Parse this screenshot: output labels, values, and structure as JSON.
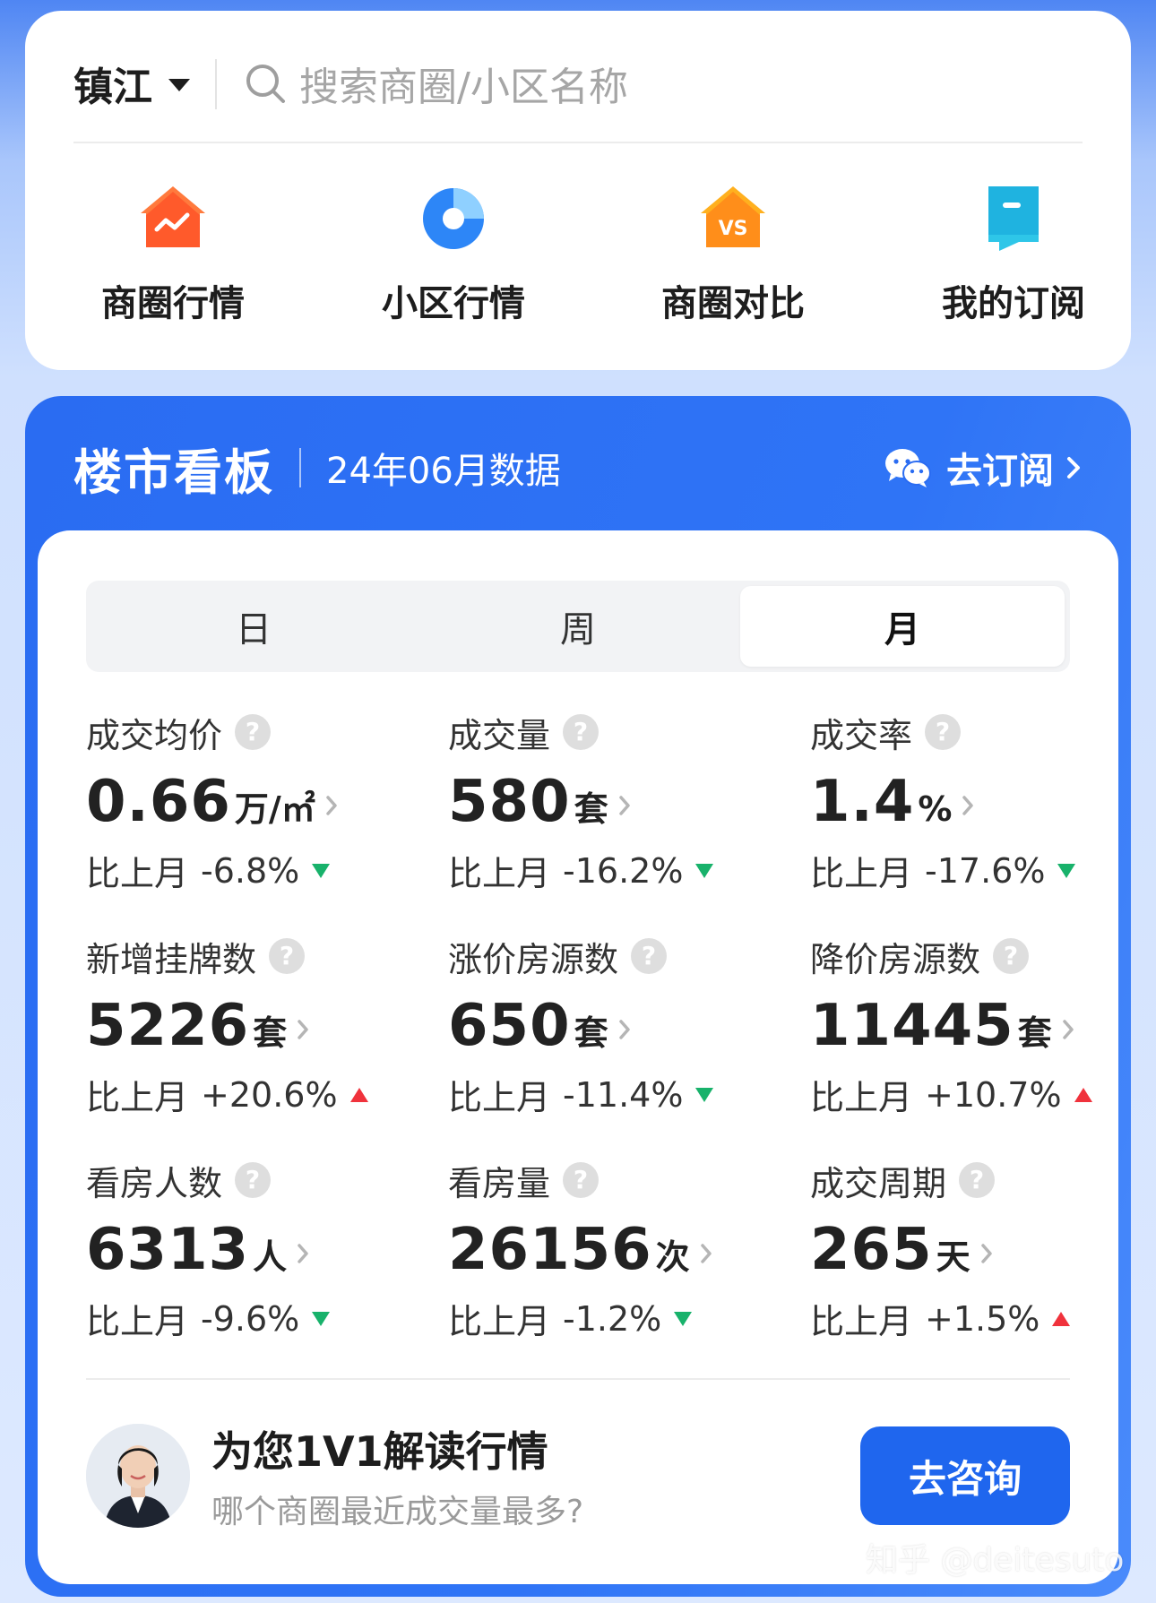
{
  "header": {
    "city": "镇江",
    "search_placeholder": "搜索商圈/小区名称"
  },
  "menu": [
    {
      "label": "商圈行情",
      "icon": "house-trend-icon"
    },
    {
      "label": "小区行情",
      "icon": "pie-chart-icon"
    },
    {
      "label": "商圈对比",
      "icon": "vs-house-icon"
    },
    {
      "label": "我的订阅",
      "icon": "bookmark-icon"
    }
  ],
  "dashboard": {
    "title": "楼市看板",
    "subtitle": "24年06月数据",
    "subscribe_label": "去订阅"
  },
  "tabs": [
    {
      "label": "日",
      "active": false
    },
    {
      "label": "周",
      "active": false
    },
    {
      "label": "月",
      "active": true
    }
  ],
  "metrics": [
    {
      "label": "成交均价",
      "value": "0.66",
      "unit": "万/㎡",
      "compare_label": "比上月",
      "change": "-6.8%",
      "trend": "down"
    },
    {
      "label": "成交量",
      "value": "580",
      "unit": "套",
      "compare_label": "比上月",
      "change": "-16.2%",
      "trend": "down"
    },
    {
      "label": "成交率",
      "value": "1.4",
      "unit": "%",
      "compare_label": "比上月",
      "change": "-17.6%",
      "trend": "down"
    },
    {
      "label": "新增挂牌数",
      "value": "5226",
      "unit": "套",
      "compare_label": "比上月",
      "change": "+20.6%",
      "trend": "up"
    },
    {
      "label": "涨价房源数",
      "value": "650",
      "unit": "套",
      "compare_label": "比上月",
      "change": "-11.4%",
      "trend": "down"
    },
    {
      "label": "降价房源数",
      "value": "11445",
      "unit": "套",
      "compare_label": "比上月",
      "change": "+10.7%",
      "trend": "up"
    },
    {
      "label": "看房人数",
      "value": "6313",
      "unit": "人",
      "compare_label": "比上月",
      "change": "-9.6%",
      "trend": "down"
    },
    {
      "label": "看房量",
      "value": "26156",
      "unit": "次",
      "compare_label": "比上月",
      "change": "-1.2%",
      "trend": "down"
    },
    {
      "label": "成交周期",
      "value": "265",
      "unit": "天",
      "compare_label": "比上月",
      "change": "+1.5%",
      "trend": "up"
    }
  ],
  "consult": {
    "title": "为您1V1解读行情",
    "subtitle": "哪个商圈最近成交量最多?",
    "button_label": "去咨询"
  },
  "watermark": "知乎 @deitesuto",
  "colors": {
    "brand_blue": "#2a6cf2",
    "down_green": "#18b26b",
    "up_red": "#f0323c"
  }
}
